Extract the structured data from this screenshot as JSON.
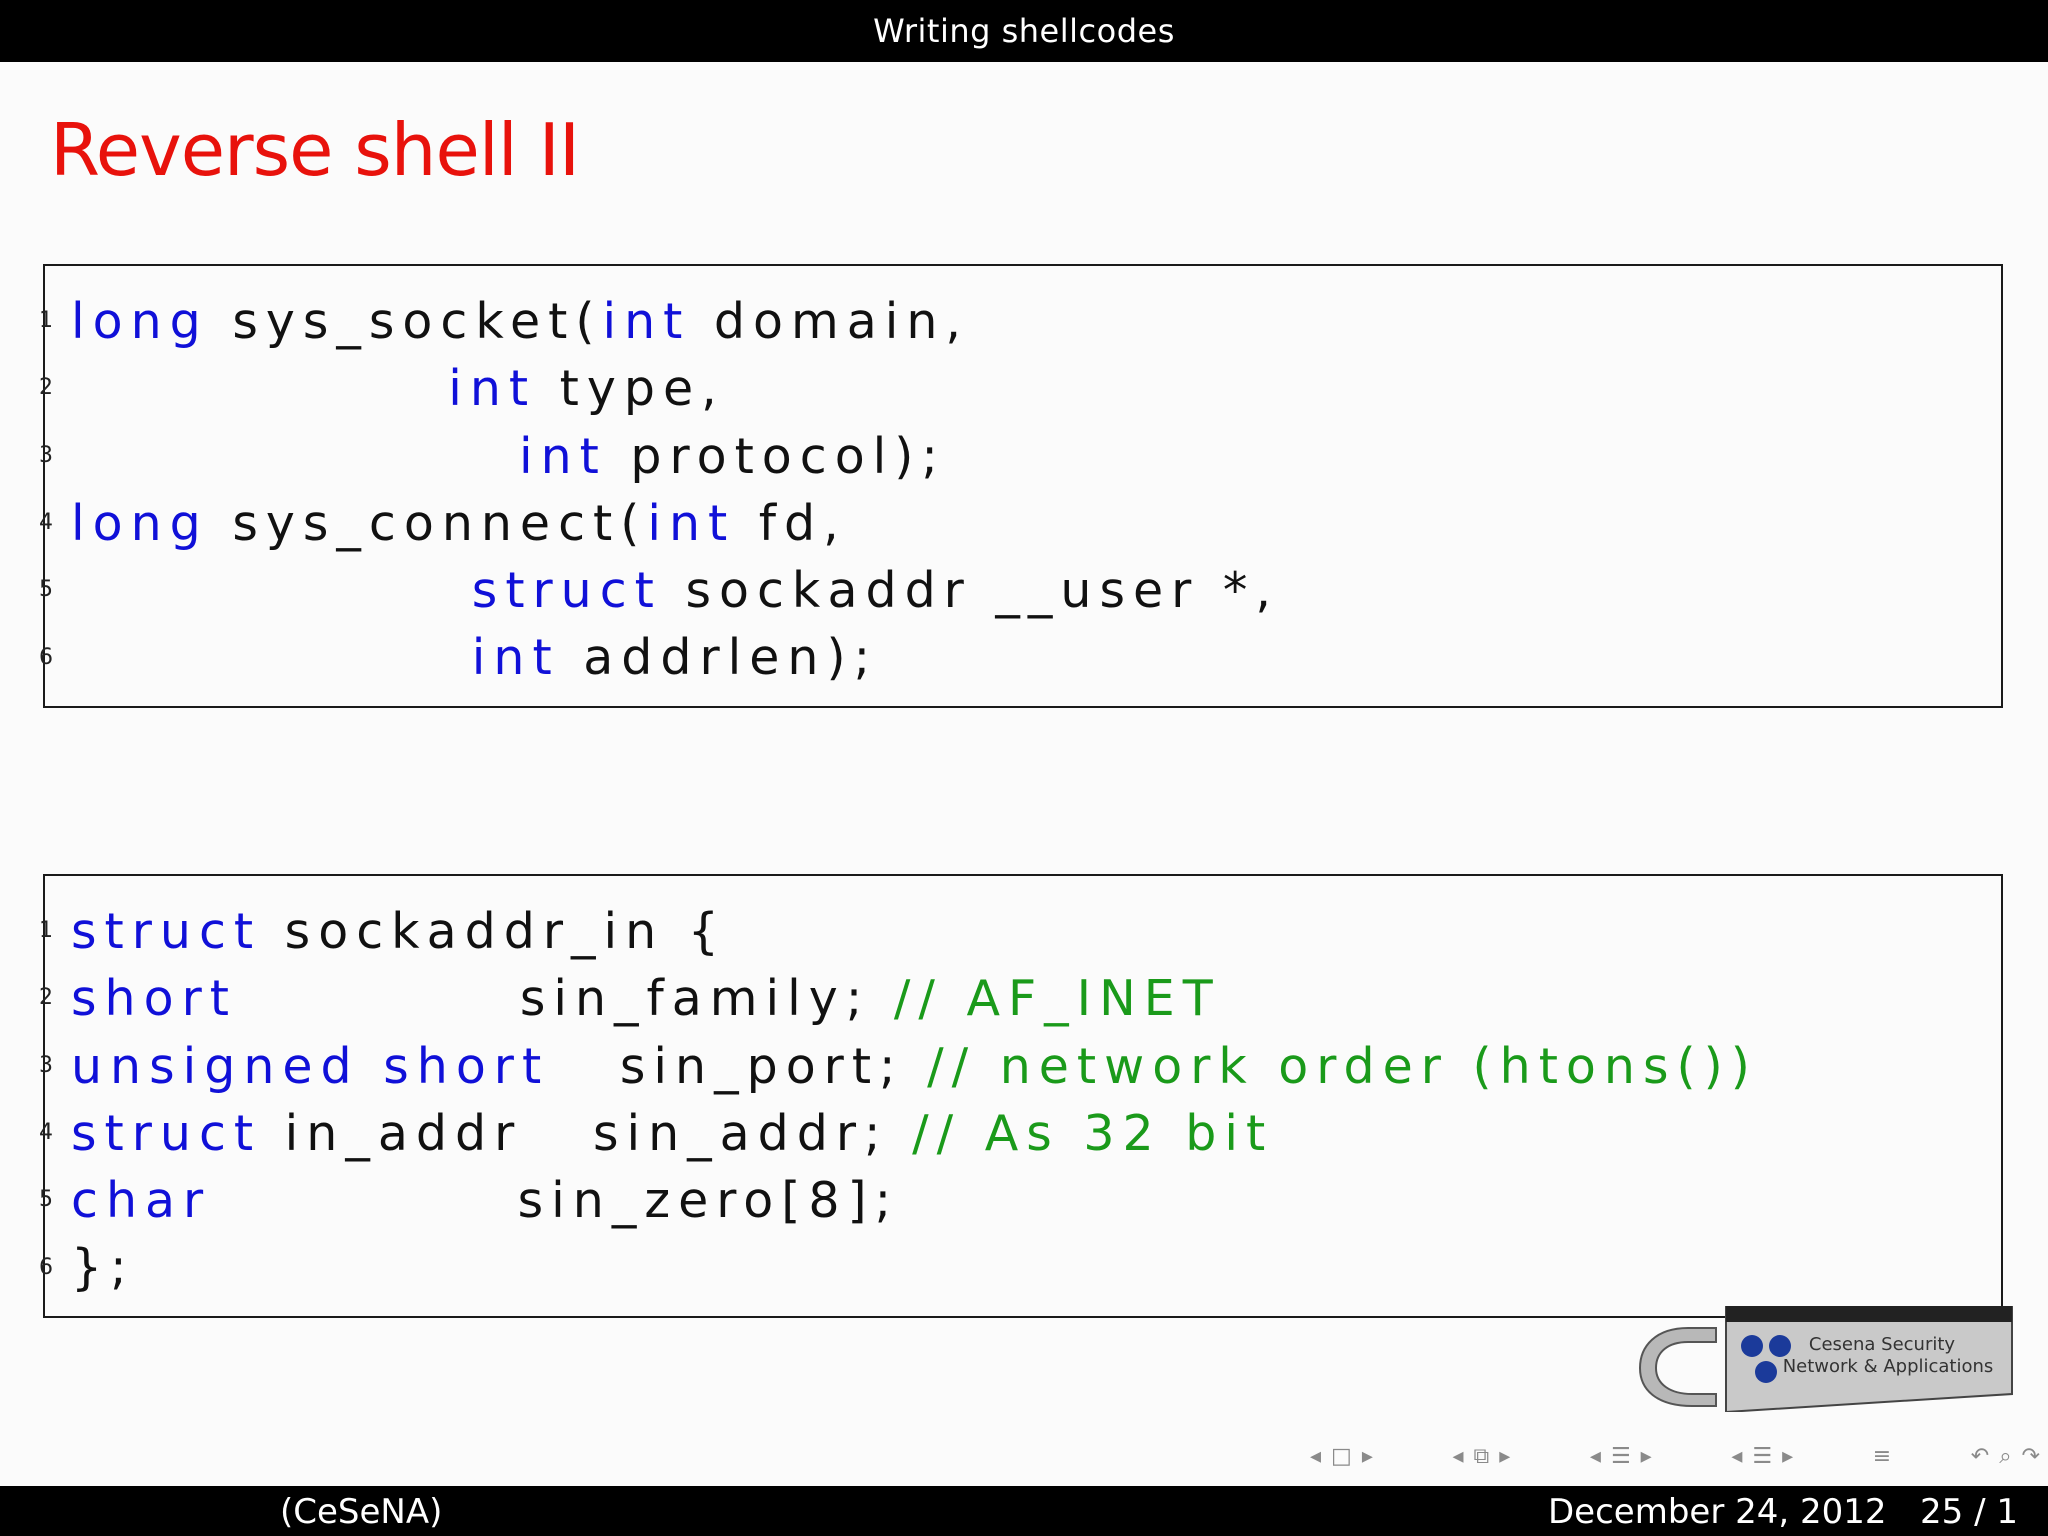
{
  "header": {
    "section_title": "Writing shellcodes"
  },
  "slide": {
    "title": "Reverse shell II"
  },
  "code_block_1": {
    "line_numbers": [
      "1",
      "2",
      "3",
      "4",
      "5",
      "6"
    ],
    "lines": [
      [
        {
          "t": "long",
          "c": "kw"
        },
        {
          "t": " sys_socket("
        },
        {
          "t": "int",
          "c": "kw"
        },
        {
          "t": " domain,"
        }
      ],
      [
        {
          "t": "                "
        },
        {
          "t": "int",
          "c": "kw"
        },
        {
          "t": " type,"
        }
      ],
      [
        {
          "t": "                   "
        },
        {
          "t": "int",
          "c": "kw"
        },
        {
          "t": " protocol);"
        }
      ],
      [
        {
          "t": "long",
          "c": "kw"
        },
        {
          "t": " sys_connect("
        },
        {
          "t": "int",
          "c": "kw"
        },
        {
          "t": " fd,"
        }
      ],
      [
        {
          "t": "                 "
        },
        {
          "t": "struct",
          "c": "kw"
        },
        {
          "t": " sockaddr __user *,"
        }
      ],
      [
        {
          "t": "                 "
        },
        {
          "t": "int",
          "c": "kw"
        },
        {
          "t": " addrlen);"
        }
      ]
    ]
  },
  "code_block_2": {
    "line_numbers": [
      "1",
      "2",
      "3",
      "4",
      "5",
      "6"
    ],
    "lines": [
      [
        {
          "t": "struct",
          "c": "kw"
        },
        {
          "t": " sockaddr_in {"
        }
      ],
      [
        {
          "t": "short",
          "c": "kw"
        },
        {
          "t": "            sin_family; "
        },
        {
          "t": "// AF_INET",
          "c": "cm"
        }
      ],
      [
        {
          "t": "unsigned short",
          "c": "kw"
        },
        {
          "t": "   sin_port; "
        },
        {
          "t": "// network order (htons())",
          "c": "cm"
        }
      ],
      [
        {
          "t": "struct",
          "c": "kw"
        },
        {
          "t": " in_addr   sin_addr; "
        },
        {
          "t": "// As 32 bit",
          "c": "cm"
        }
      ],
      [
        {
          "t": "char",
          "c": "kw"
        },
        {
          "t": "             sin_zero[8];"
        }
      ],
      [
        {
          "t": "};"
        }
      ]
    ]
  },
  "logo": {
    "line1": "Cesena Security",
    "line2": "Network & Applications"
  },
  "footer": {
    "author": "(CeSeNA)",
    "date": "December 24, 2012",
    "page": "25 / 1"
  },
  "colors": {
    "title": "#e8120c",
    "keyword": "#1010d8",
    "comment": "#1a9a1a"
  },
  "nav_icons": [
    "frame-nav-icon",
    "subsection-nav-icon",
    "section-nav-icon",
    "toc-nav-icon",
    "appendix-icon",
    "search-undo-icons"
  ]
}
